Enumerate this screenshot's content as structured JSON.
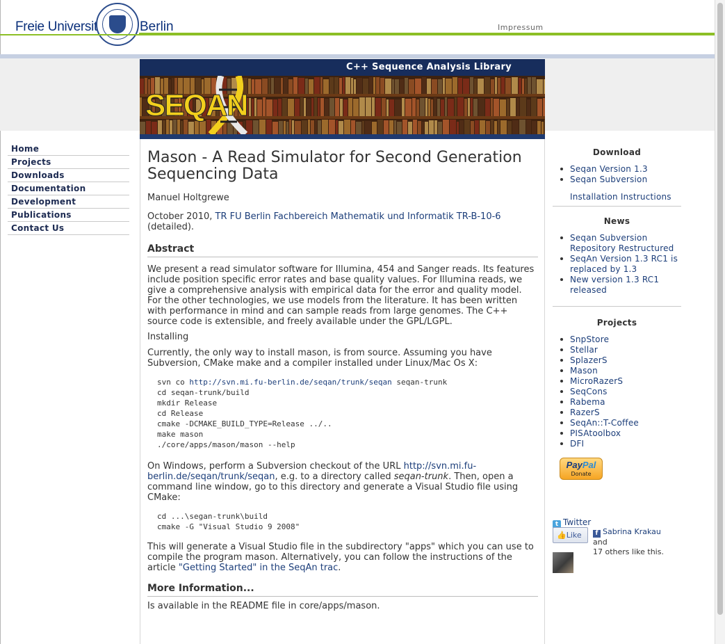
{
  "header": {
    "university_left": "Freie Universität",
    "university_right": "Berlin",
    "impressum": "Impressum"
  },
  "banner": {
    "title": "C++ Sequence Analysis Library",
    "logo_text": "SEQAN"
  },
  "nav": {
    "items": [
      {
        "label": "Home"
      },
      {
        "label": "Projects"
      },
      {
        "label": "Downloads"
      },
      {
        "label": "Documentation"
      },
      {
        "label": "Development"
      },
      {
        "label": "Publications"
      },
      {
        "label": "Contact Us"
      }
    ]
  },
  "main": {
    "title": "Mason - A Read Simulator for Second Generation Sequencing Data",
    "author": "Manuel Holtgrewe",
    "date_prefix": "October 2010, ",
    "report_link": "TR FU Berlin Fachbereich Mathematik und Informatik TR-B-10-6",
    "date_suffix": " (detailed).",
    "abstract_heading": "Abstract",
    "abstract_text": "We present a read simulator software for Illumina, 454 and Sanger reads. Its features include position specific error rates and base quality values. For Illumina reads, we give a comprehensive analysis with empirical data for the error and quality model. For the other technologies, we use models from the literature. It has been written with performance in mind and can sample reads from large genomes. The C++ source code is extensible, and freely available under the GPL/LGPL.",
    "installing_label": "Installing",
    "install_intro": "Currently, the only way to install mason, is from source. Assuming you have Subversion, CMake make and a compiler installed under Linux/Mac Os X:",
    "code1_prefix": "svn co ",
    "code1_link": "http://svn.mi.fu-berlin.de/seqan/trunk/seqan",
    "code1_suffix": " seqan-trunk",
    "code1_rest": "cd seqan-trunk/build\nmkdir Release\ncd Release\ncmake -DCMAKE_BUILD_TYPE=Release ../..\nmake mason\n./core/apps/mason/mason --help",
    "windows_prefix": "On Windows, perform a Subversion checkout of the URL ",
    "windows_link": "http://svn.mi.fu-berlin.de/seqan/trunk/seqan",
    "windows_mid": ", e.g. to a directory called ",
    "windows_dir": "seqan-trunk",
    "windows_suffix": ". Then, open a command line window, go to this directory and generate a Visual Studio file using CMake:",
    "code2": "cd ...\\segan-trunk\\build\ncmake -G \"Visual Studio 9 2008\"",
    "vs_prefix": "This will generate a Visual Studio file in the subdirectory \"apps\" which you can use to compile the program mason. Alternatively, you can follow the instructions of the article ",
    "vs_link": "\"Getting Started\" in the SeqAn trac",
    "vs_suffix": ".",
    "more_heading": "More Information...",
    "more_text": "Is available in the README file in core/apps/mason."
  },
  "sidebar": {
    "download_heading": "Download",
    "download_items": [
      "Seqan Version 1.3",
      "Seqan Subversion"
    ],
    "install_link": "Installation Instructions",
    "news_heading": "News",
    "news_items": [
      "Seqan Subversion Repository Restructured",
      "SeqAn Version 1.3 RC1 is replaced by 1.3",
      "New version 1.3 RC1 released"
    ],
    "projects_heading": "Projects",
    "projects_items": [
      "SnpStore",
      "Stellar",
      "SplazerS",
      "Mason",
      "MicroRazerS",
      "SeqCons",
      "Rabema",
      "RazerS",
      "SeqAn::T-Coffee",
      "PISAtoolbox",
      "DFI"
    ],
    "paypal_word_1": "Pay",
    "paypal_word_2": "Pal",
    "paypal_donate": "Donate",
    "twitter": "Twitter",
    "like": "Like",
    "fb_name": "Sabrina Krakau",
    "fb_and": " and",
    "fb_others": "17 others like this."
  },
  "colors": {
    "green_bar": "#8cbf26",
    "blue_bar": "#c6d0e2",
    "banner_navy": "#1f3a70",
    "link": "#1c3e7a",
    "logo_yellow": "#f2cf1d"
  }
}
